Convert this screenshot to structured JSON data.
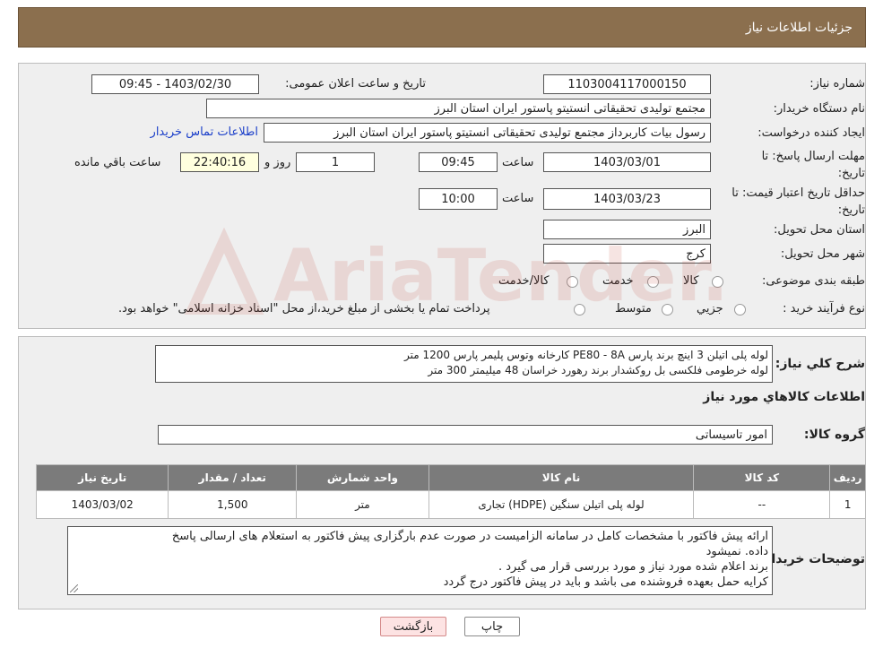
{
  "header": {
    "title": "جزئیات اطلاعات نیاز"
  },
  "form": {
    "need_number_label": "شماره نیاز:",
    "need_number": "1103004117000150",
    "announce_label": "تاریخ و ساعت اعلان عمومی:",
    "announce_value": "1403/02/30 - 09:45",
    "buyer_org_label": "نام دستگاه خریدار:",
    "buyer_org": "مجتمع تولیدی تحقیقاتی انستیتو پاستور ایران استان البرز",
    "creator_label": "ایجاد کننده درخواست:",
    "creator": "رسول بیات کاربرداز مجتمع تولیدی تحقیقاتی انستیتو پاستور ایران استان البرز",
    "contact_link": "اطلاعات تماس خریدار",
    "deadline_label_1": "مهلت ارسال پاسخ: تا",
    "deadline_label_2": "تاریخ:",
    "deadline_date": "1403/03/01",
    "time_label": "ساعت",
    "deadline_time": "09:45",
    "days_value": "1",
    "days_label": "روز و",
    "remaining_time": "22:40:16",
    "remaining_label": "ساعت باقي مانده",
    "validity_label_1": "حداقل تاریخ اعتبار قیمت: تا",
    "validity_label_2": "تاریخ:",
    "validity_date": "1403/03/23",
    "validity_time": "10:00",
    "province_label": "استان محل تحویل:",
    "province": "البرز",
    "city_label": "شهر محل تحویل:",
    "city": "کرج",
    "category_label": "طبقه بندی موضوعی:",
    "category_options": [
      "کالا",
      "خدمت",
      "کالا/خدمت"
    ],
    "process_label": "نوع فرآیند خرید :",
    "process_options": [
      "جزیي",
      "متوسط"
    ],
    "payment_note": "پرداخت تمام یا بخشی از مبلغ خرید،از محل \"اسناد خزانه اسلامی\" خواهد بود."
  },
  "description": {
    "label": "شرح کلي نیاز:",
    "lines": [
      "لوله پلی اتیلن 3 اینچ برند پارس PE80 - 8A کارخانه وتوس پلیمر پارس 1200 متر",
      "لوله خرطومی فلکسی بل روکشدار برند رهورد خراسان 48 میلیمتر      300 متر"
    ]
  },
  "items_section": {
    "title": "اطلاعات کالاهاي مورد نیاز",
    "group_label": "گروه کالا:",
    "group_value": "امور تاسیساتی",
    "columns": [
      "ردیف",
      "کد کالا",
      "نام کالا",
      "واحد شمارش",
      "تعداد / مقدار",
      "تاریخ نیاز"
    ],
    "rows": [
      [
        "1",
        "--",
        "لوله پلی اتیلن سنگین (HDPE) تجاری",
        "متر",
        "1,500",
        "1403/03/02"
      ]
    ]
  },
  "buyer_notes": {
    "label": "توضیحات خریدار:",
    "lines": [
      "ارائه پیش فاکتور با مشخصات کامل در سامانه الزامیست در صورت عدم بارگزاری پیش فاکتور به استعلام های ارسالی پاسخ",
      "داده. نمیشود",
      "برند اعلام شده مورد نیاز و مورد  بررسی قرار می گیرد .",
      "کرایه حمل بعهده فروشنده می باشد و باید در پیش فاکتور درج گردد"
    ]
  },
  "buttons": {
    "print": "چاپ",
    "back": "بازگشت"
  },
  "watermark": {
    "text": "AriaTender.neT"
  }
}
